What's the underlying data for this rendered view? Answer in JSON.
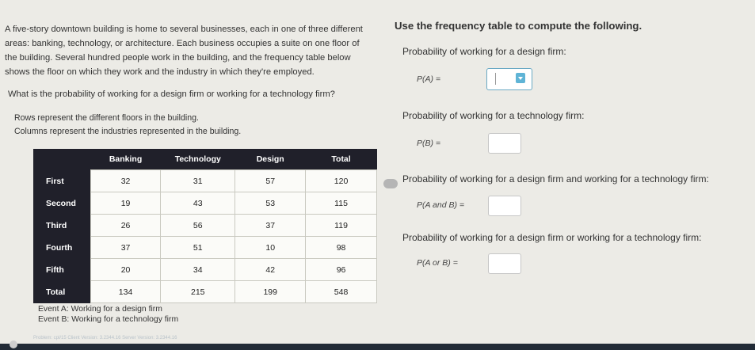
{
  "problem": {
    "intro": "A five-story downtown building is home to several businesses, each in one of three different areas: banking, technology, or architecture. Each business occupies a suite on one floor of the building. Several hundred people work in the building, and the frequency table below shows the floor on which they work and the industry in which they're employed.",
    "question": "What is the probability of working for a design firm or working for a technology firm?",
    "rows_note": "Rows represent the different floors in the building.",
    "cols_note": "Columns represent the industries represented in the building."
  },
  "table": {
    "headers": [
      "Banking",
      "Technology",
      "Design",
      "Total"
    ],
    "rows": [
      {
        "label": "First",
        "values": [
          "32",
          "31",
          "57",
          "120"
        ]
      },
      {
        "label": "Second",
        "values": [
          "19",
          "43",
          "53",
          "115"
        ]
      },
      {
        "label": "Third",
        "values": [
          "26",
          "56",
          "37",
          "119"
        ]
      },
      {
        "label": "Fourth",
        "values": [
          "37",
          "51",
          "10",
          "98"
        ]
      },
      {
        "label": "Fifth",
        "values": [
          "20",
          "34",
          "42",
          "96"
        ]
      },
      {
        "label": "Total",
        "values": [
          "134",
          "215",
          "199",
          "548"
        ]
      }
    ]
  },
  "events": {
    "a": "Event A: Working for a design firm",
    "b": "Event B: Working for a technology firm"
  },
  "footer": "Problem: cpl/15   Client Version: 3.2344.16   Server Version: 3.2344.16",
  "right": {
    "heading": "Use the frequency table to compute the following.",
    "q1_label": "Probability of working for a design firm:",
    "q1_expr": "P(A) =",
    "q2_label": "Probability of working for a technology firm:",
    "q2_expr": "P(B) =",
    "q3_label": "Probability of working for a design firm and working for a technology firm:",
    "q3_expr": "P(A and B) =",
    "q4_label": "Probability of working for a design firm or working for a technology firm:",
    "q4_expr": "P(A or B) ="
  }
}
